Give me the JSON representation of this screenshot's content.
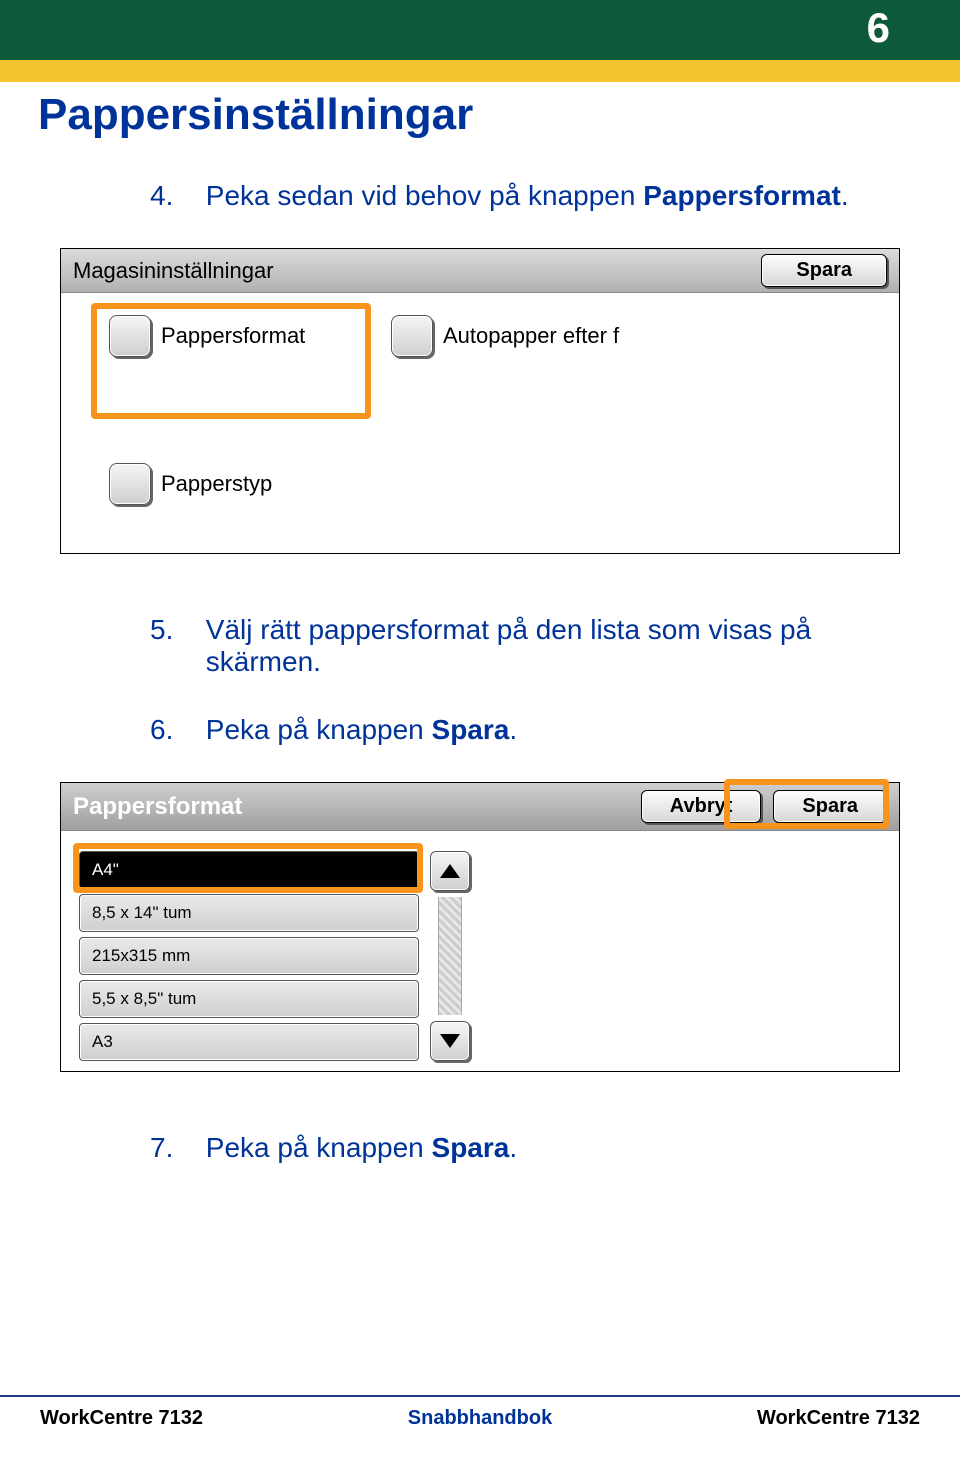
{
  "page_number": "6",
  "title": "Pappersinställningar",
  "instructions": {
    "s4": {
      "num": "4.",
      "text_pre": "Peka sedan vid behov på knappen ",
      "bold": "Pappersformat",
      "suffix": "."
    },
    "s5": {
      "num": "5.",
      "text": "Välj rätt pappersformat på den lista som visas på skärmen."
    },
    "s6": {
      "num": "6.",
      "text_pre": "Peka på knappen ",
      "bold": "Spara",
      "suffix": "."
    },
    "s7": {
      "num": "7.",
      "text_pre": "Peka på knappen ",
      "bold": "Spara",
      "suffix": "."
    }
  },
  "panel1": {
    "title": "Magasininställningar",
    "save_label": "Spara",
    "opt1": "Pappersformat",
    "opt2": "Autopapper efter f",
    "opt3": "Papperstyp"
  },
  "panel2": {
    "title": "Pappersformat",
    "cancel_label": "Avbryt",
    "save_label": "Spara",
    "items": [
      "A4\"",
      "8,5 x 14\" tum",
      "215x315 mm",
      "5,5 x 8,5\" tum",
      "A3"
    ]
  },
  "footer": {
    "left": "WorkCentre 7132",
    "center": "Snabbhandbok",
    "right": "WorkCentre 7132"
  }
}
